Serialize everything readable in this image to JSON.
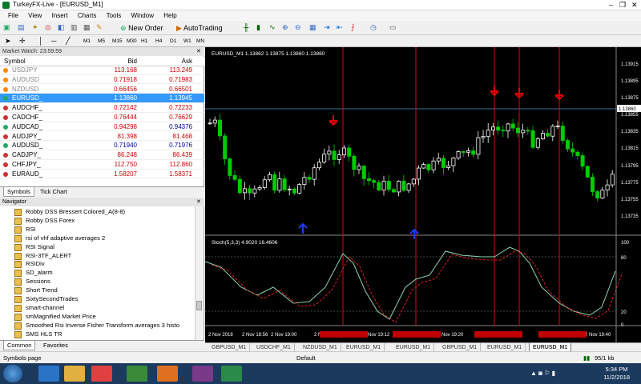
{
  "window": {
    "title": "TurkeyFX-Live - [EURUSD_M1]"
  },
  "menu": [
    "File",
    "View",
    "Insert",
    "Charts",
    "Tools",
    "Window",
    "Help"
  ],
  "toolbar": {
    "new_order": "New Order",
    "autotrading": "AutoTrading"
  },
  "timeframes": [
    "M1",
    "M5",
    "M15",
    "M30",
    "H1",
    "H4",
    "D1",
    "W1",
    "MN"
  ],
  "market_watch": {
    "title": "Market Watch: 23:59:59",
    "columns": [
      "Symbol",
      "Bid",
      "Ask"
    ],
    "rows": [
      {
        "symbol": "USDJPY",
        "bid": "113.168",
        "ask": "113.249"
      },
      {
        "symbol": "AUDUSD",
        "bid": "0.71918",
        "ask": "0.71983"
      },
      {
        "symbol": "NZDUSD",
        "bid": "0.66456",
        "ask": "0.66501"
      },
      {
        "symbol": "EURUSD_",
        "bid": "1.13860",
        "ask": "1.13945"
      },
      {
        "symbol": "AUDCHF_",
        "bid": "0.72142",
        "ask": "0.72233"
      },
      {
        "symbol": "CADCHF_",
        "bid": "0.76444",
        "ask": "0.76629"
      },
      {
        "symbol": "AUDCAD_",
        "bid": "0.94298",
        "ask": "0.94376"
      },
      {
        "symbol": "AUDJPY_",
        "bid": "81.398",
        "ask": "81.468"
      },
      {
        "symbol": "AUDUSD_",
        "bid": "0.71940",
        "ask": "0.71976"
      },
      {
        "symbol": "CADJPY_",
        "bid": "86.248",
        "ask": "86.439"
      },
      {
        "symbol": "CHFJPY_",
        "bid": "112.750",
        "ask": "112.860"
      },
      {
        "symbol": "EURAUD_",
        "bid": "1.58207",
        "ask": "1.58371"
      }
    ],
    "tabs": [
      "Symbols",
      "Tick Chart"
    ]
  },
  "navigator": {
    "title": "Navigator",
    "items": [
      "Robby DSS Bressert Colored_A(8-8)",
      "Robby DSS Forex",
      "RSI",
      "rsi of vhf adaptive averages 2",
      "RSI Signal",
      "RSI-3TF_ALERT",
      "RSIDiv",
      "SD_alarm",
      "Sessions",
      "Short Trend",
      "SixtySecondTrades",
      "smart-channel",
      "smMagnified Market Price",
      "Smoothed Rsi Inverse Fisher Transform averages 3 histo",
      "SMS HLS TR"
    ],
    "tabs": [
      "Common",
      "Favorites"
    ]
  },
  "chart": {
    "header": "EURUSD_M1  1.13862 1.13875 1.13860 1.13860",
    "price_labels": [
      "1.13915",
      "1.13895",
      "1.13875",
      "1.13855",
      "1.13835",
      "1.13815",
      "1.13795",
      "1.13775",
      "1.13755",
      "1.13735"
    ],
    "current_price": "1.13860",
    "stoch_header": "Stoch(5,3,3) 4.9020 16.4606",
    "stoch_labels": [
      "100",
      "80",
      "20",
      "0"
    ],
    "time_labels": [
      "2 Nov 2018",
      "2 Nov 18:56",
      "2 Nov 19:00",
      "2 Nov 19",
      "2 Nov 19:12",
      "2 Nov 19:20",
      "2 Nov 19:40"
    ],
    "bull_color": "#ffffff",
    "bear_color": "#00cc00",
    "arrow_down_color": "#e00000",
    "arrow_up_color": "#1a3cff"
  },
  "chart_tabs": [
    "GBPUSD_M1",
    "USDCHF_M1",
    "NZDUSD_M1",
    "EURUSD_M1",
    "EURUSD_M1",
    "GBPUSD_M1",
    "EURUSD_M1",
    "EURUSD_M1"
  ],
  "status": {
    "left": "Symbols page",
    "center": "Default",
    "right": "95/1 kb"
  },
  "taskbar": {
    "time": "5:34 PM",
    "date": "11/2/2018"
  }
}
